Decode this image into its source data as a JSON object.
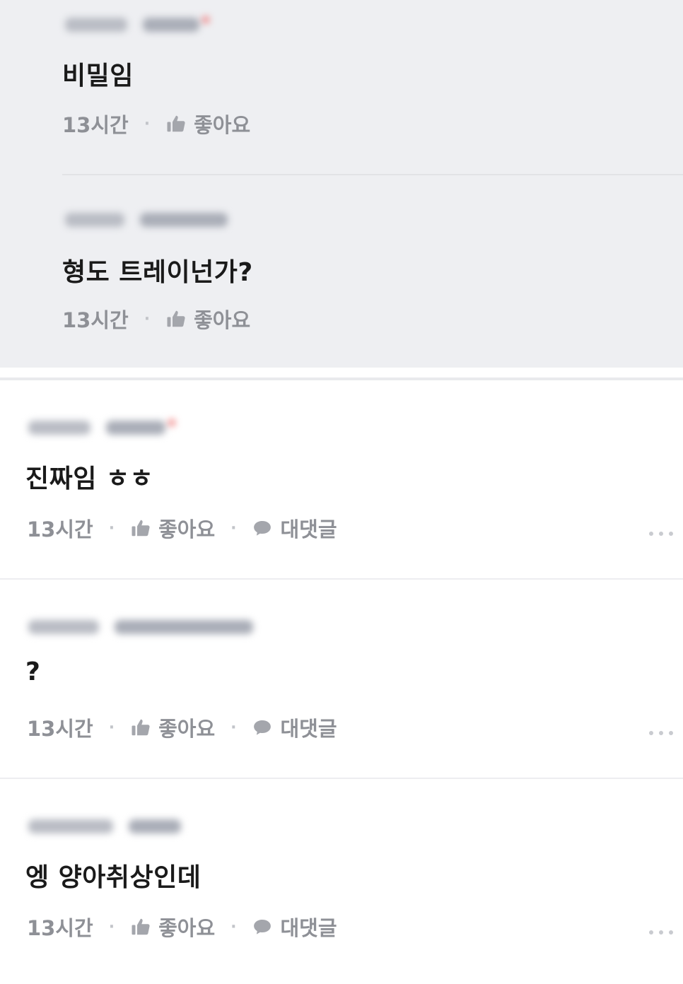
{
  "replies": [
    {
      "text": "비밀임",
      "time": "13시간",
      "like_label": "좋아요"
    },
    {
      "text": "형도 트레이넌가?",
      "time": "13시간",
      "like_label": "좋아요"
    }
  ],
  "comments": [
    {
      "text": "진짜임 ㅎㅎ",
      "time": "13시간",
      "like_label": "좋아요",
      "reply_label": "대댓글"
    },
    {
      "text": "?",
      "time": "13시간",
      "like_label": "좋아요",
      "reply_label": "대댓글"
    },
    {
      "text": "엥 양아취상인데",
      "time": "13시간",
      "like_label": "좋아요",
      "reply_label": "대댓글"
    }
  ],
  "icons": {
    "like": "thumbs-up-icon",
    "reply": "speech-bubble-icon",
    "more": "more-dots-icon"
  },
  "colors": {
    "reply_bg": "#eeeff2",
    "meta_text": "#8e9096",
    "body_text": "#1a1a1a"
  }
}
